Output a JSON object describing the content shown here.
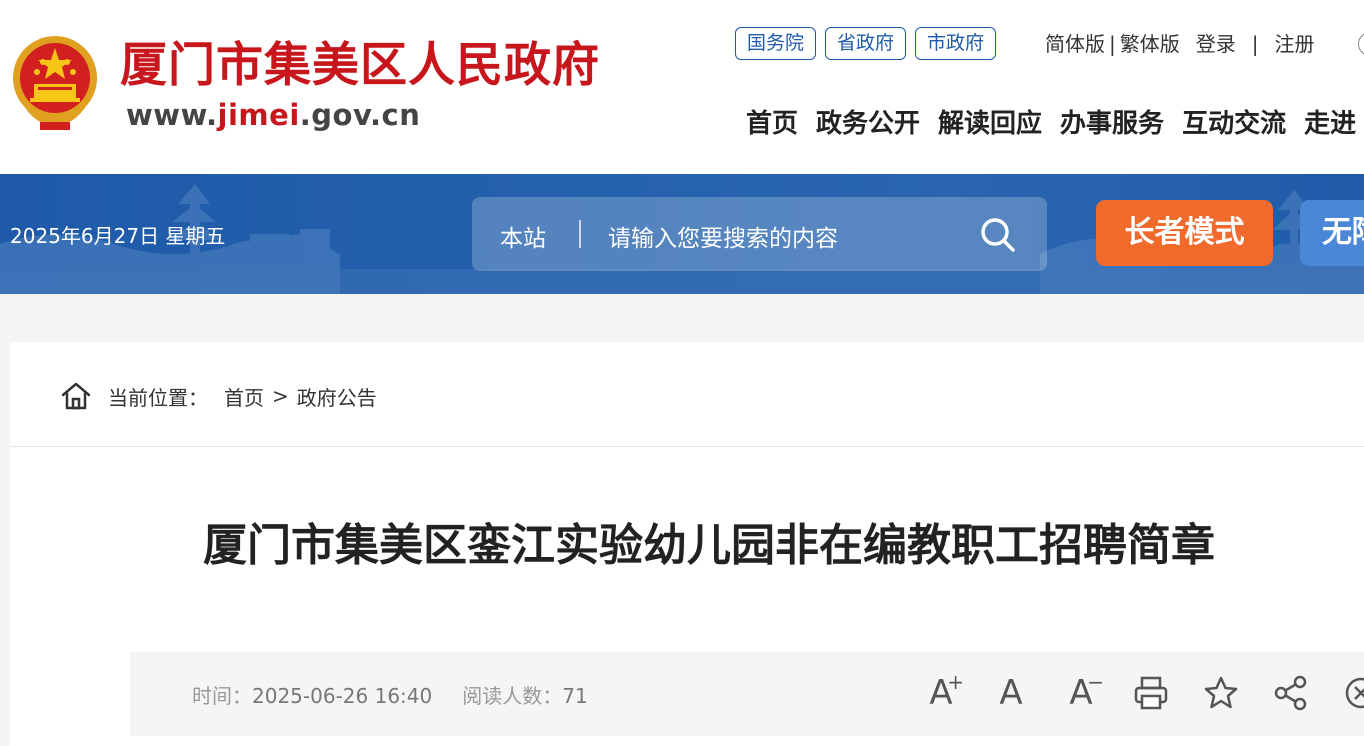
{
  "header": {
    "site_name": "厦门市集美区人民政府",
    "site_url_prefix": "www.",
    "site_url_highlight": "jimei",
    "site_url_suffix": ".gov.cn",
    "gov_links": [
      "国务院",
      "省政府",
      "市政府"
    ],
    "version_simplified": "简体版",
    "version_separator": "|",
    "version_traditional": "繁体版",
    "login": "登录",
    "auth_separator": "|",
    "register": "注册",
    "nav": [
      "首页",
      "政务公开",
      "解读回应",
      "办事服务",
      "互动交流",
      "走进"
    ]
  },
  "banner": {
    "date": "2025年6月27日 星期五",
    "search_scope": "本站",
    "search_placeholder": "请输入您要搜索的内容",
    "elder_mode": "长者模式",
    "accessibility_mode": "无障"
  },
  "breadcrumb": {
    "label": "当前位置：",
    "home": "首页",
    "separator": ">",
    "current": "政府公告"
  },
  "article": {
    "title": "厦门市集美区銮江实验幼儿园非在编教职工招聘简章",
    "time_label": "时间：",
    "time_value": "2025-06-26 16:40",
    "views_label": "阅读人数：",
    "views_value": "71"
  },
  "tools": {
    "font_larger": "A",
    "font_larger_mark": "+",
    "font_default": "A",
    "font_smaller": "A",
    "font_smaller_mark": "−"
  },
  "colors": {
    "brand_red": "#c8161d",
    "banner_blue": "#1f5ba8",
    "elder_orange": "#ef6a2b"
  }
}
